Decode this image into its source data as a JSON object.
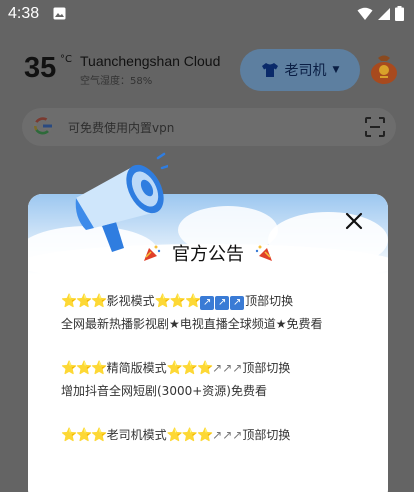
{
  "status_bar": {
    "time": "4:38"
  },
  "header": {
    "temperature": "35",
    "temp_unit": "°C",
    "city": "Tuanchengshan   Cloud",
    "humidity": "空气湿度：58%",
    "mode_label": "老司机"
  },
  "search": {
    "placeholder": "可免费使用内置vpn"
  },
  "dialog": {
    "title": "官方公告",
    "items": [
      {
        "stars_a": "⭐⭐⭐",
        "name": "影视模式",
        "stars_b": "⭐⭐⭐",
        "arrows": "↗↗↗",
        "action": "顶部切换",
        "desc": "全网最新热播影视剧★电视直播全球频道★免费看"
      },
      {
        "stars_a": "⭐⭐⭐",
        "name": "精简版模式",
        "stars_b": "⭐⭐⭐",
        "arrows": "↗↗↗",
        "action": "顶部切换",
        "desc": "增加抖音全网短剧(3000+资源)免费看"
      },
      {
        "stars_a": "⭐⭐⭐",
        "name": "老司机模式",
        "stars_b": "⭐⭐⭐",
        "arrows": "↗↗↗",
        "action": "顶部切换",
        "desc": ""
      }
    ]
  },
  "colors": {
    "overlay": "#646464",
    "accent_blue": "#3a7bd5",
    "star": "#f4b400"
  }
}
